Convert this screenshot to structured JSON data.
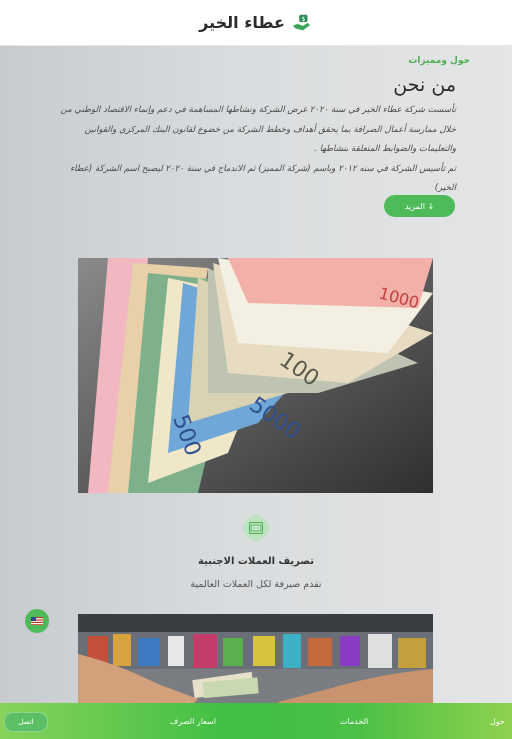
{
  "header": {
    "brand": "عطاء الخير",
    "logo_icon": "hand-money-icon"
  },
  "about": {
    "tag": "حول ومميزات",
    "title": "من نحن",
    "paragraph1": "تأسست شركة عطاء الخير في سنة ٢٠٢٠ غرض الشركة ونشاطها المساهمة في دعم وإنماء الاقتصاد الوطني من خلال ممارسة أعمال الصرافة بما يحقق أهداف وخطط الشركة من خضوع لقانون البنك المركزي والقوانين والتعليمات والضوابط المتعلقة بنشاطها .",
    "paragraph2": "تم تأسيس الشركة في سنه ٢٠١٢ وباسم (شركة المميز) ثم الاندماج في سنة ٢٠٢٠ ليصبح اسم الشركة (عطاء الخير)",
    "more_label": "المزيد ↓"
  },
  "hero_image": "currency-banknotes-photo",
  "service": {
    "icon": "money-exchange-icon",
    "title": "تصريف العملات الاجنبية",
    "desc": "تقدم صيرفة لكل العملات العالمية"
  },
  "language": {
    "icon": "us-flag-icon"
  },
  "shop_image": "shop-money-exchange-photo",
  "bottom_nav": {
    "about": "حول",
    "services": "الخدمات",
    "rates": "اسعار الصرف",
    "contact": "اتصل"
  },
  "colors": {
    "accent": "#4fba5a",
    "nav_light": "#88d25b",
    "nav_dark": "#3fbf43"
  }
}
